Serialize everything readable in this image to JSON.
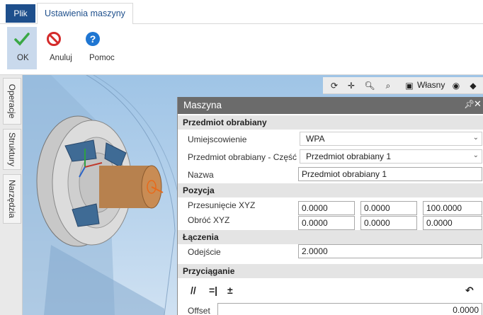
{
  "ribbon": {
    "file_tab": "Plik",
    "active_tab": "Ustawienia maszyny",
    "buttons": {
      "ok": "OK",
      "cancel": "Anuluj",
      "help": "Pomoc"
    },
    "colors": {
      "file_tab_bg": "#1e4f8c",
      "ok_green": "#3aa845",
      "cancel_red": "#d42b2b",
      "help_blue": "#1f76d2"
    }
  },
  "side_tabs": [
    "Operacje",
    "Struktury",
    "Narzędzia"
  ],
  "view_toolbar": {
    "icons": [
      "rotate-icon",
      "pan-icon",
      "zoom-icon",
      "zoom-window-icon",
      "view-preset-icon",
      "eye-icon",
      "render-icon"
    ],
    "preset_label": "Własny"
  },
  "panel": {
    "title": "Maszyna",
    "sections": {
      "workpiece": "Przedmiot obrabiany",
      "position": "Pozycja",
      "connections": "Łączenia",
      "snapping": "Przyciąganie"
    },
    "workpiece": {
      "location_label": "Umiejscowienie",
      "location_value": "WPA",
      "part_label": "Przedmiot obrabiany - Część",
      "part_value": "Przedmiot obrabiany 1",
      "name_label": "Nazwa",
      "name_value": "Przedmiot obrabiany 1"
    },
    "position": {
      "offset_label": "Przesunięcie XYZ",
      "offset_values": [
        "0.0000",
        "0.0000",
        "100.0000"
      ],
      "rotate_label": "Obróć XYZ",
      "rotate_values": [
        "0.0000",
        "0.0000",
        "0.0000"
      ]
    },
    "connections": {
      "distance_label": "Odejście",
      "distance_value": "2.0000"
    },
    "snapping": {
      "offset_label": "Offset",
      "offset_value": "0.0000"
    }
  }
}
